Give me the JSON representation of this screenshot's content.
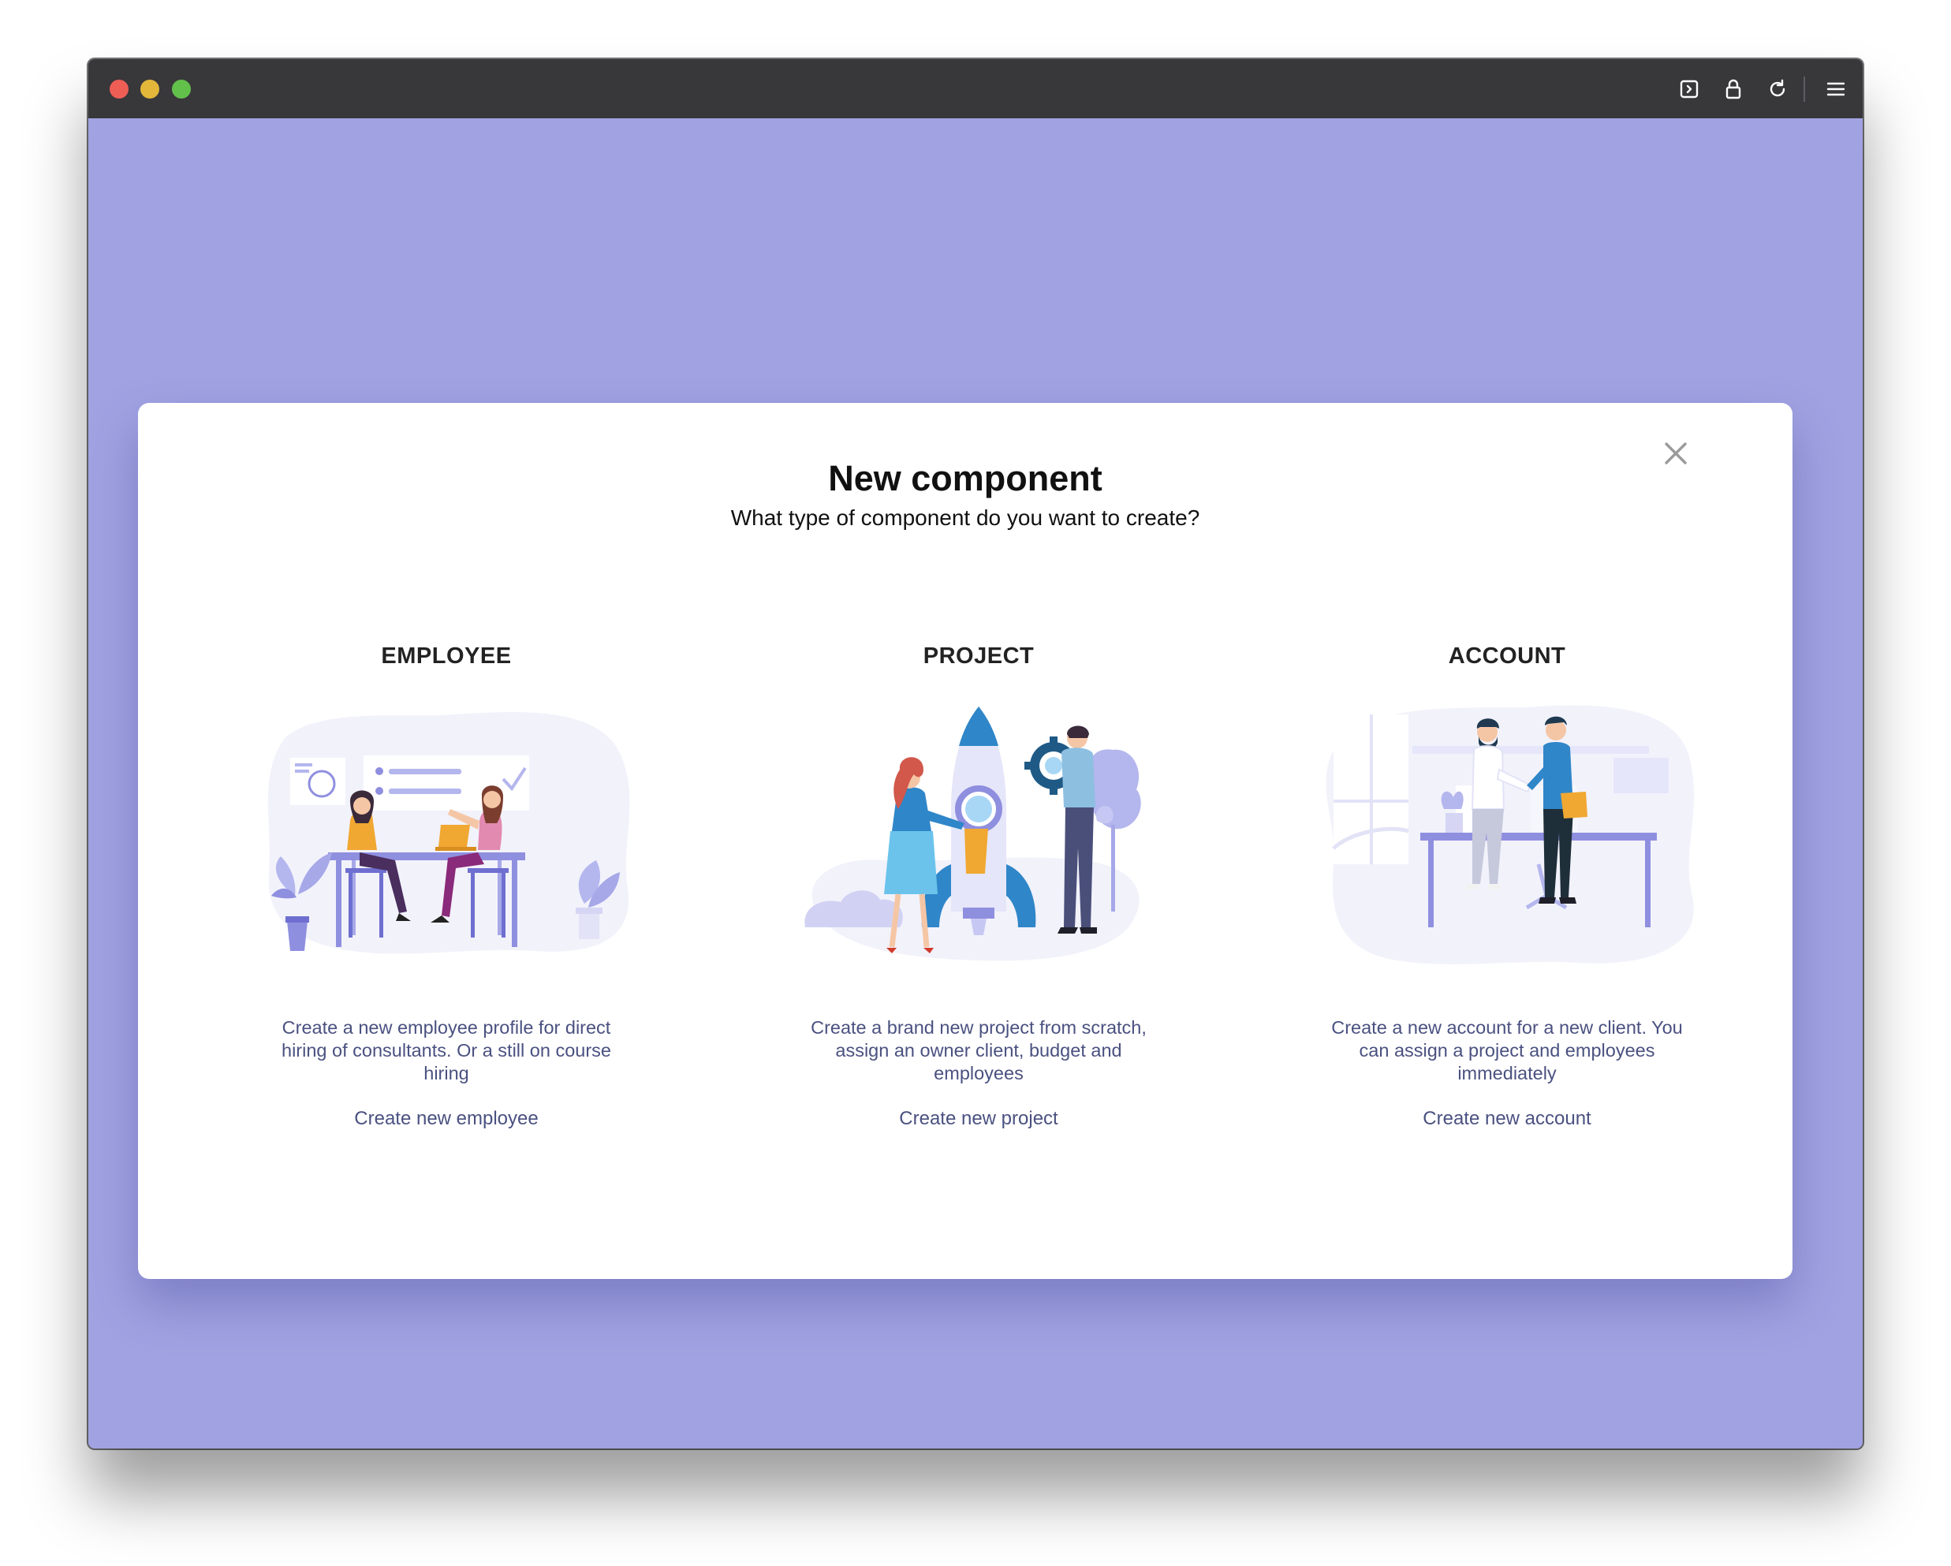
{
  "modal": {
    "title": "New component",
    "subtitle": "What type of component do you want to create?"
  },
  "cards": [
    {
      "title": "EMPLOYEE",
      "description": "Create a new employee profile for direct hiring of consultants. Or a still on course hiring",
      "link": "Create new employee"
    },
    {
      "title": "PROJECT",
      "description": "Create a brand new project from scratch, assign an owner client, budget and employees",
      "link": "Create new project"
    },
    {
      "title": "ACCOUNT",
      "description": "Create a new account for a new client. You can assign a project and employees immediately",
      "link": "Create new account"
    }
  ],
  "colors": {
    "background": "#a0a2e2",
    "titlebar": "#38373a",
    "modal": "#ffffff",
    "text_muted": "#4a5180",
    "illustration_purple": "#8f8fe0",
    "illustration_blue": "#2f86c8",
    "illustration_orange": "#f0a832"
  },
  "icons": {
    "titlebar": [
      "sidebar-toggle-icon",
      "lock-icon",
      "reload-icon",
      "menu-icon"
    ],
    "modal": [
      "close-icon"
    ]
  }
}
